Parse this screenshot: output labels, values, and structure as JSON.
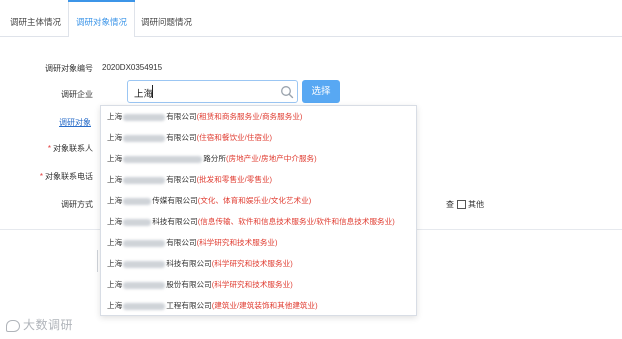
{
  "tabs": [
    {
      "label": "调研主体情况"
    },
    {
      "label": "调研对象情况"
    },
    {
      "label": "调研问题情况"
    }
  ],
  "form": {
    "code_label": "调研对象编号",
    "code_value": "2020DX0354915",
    "company_label": "调研企业",
    "search_value": "上海",
    "select_button": "选择",
    "object_link": "调研对象",
    "contact_label": "对象联系人",
    "phone_label": "对象联系电话",
    "method_label": "调研方式",
    "required_mark": "*",
    "cut_option_suffix": "查",
    "other_option": "其他"
  },
  "dropdown": {
    "items": [
      {
        "prefix": "上海",
        "suffix": "有限公司",
        "industry": "(租赁和商务服务业/商务服务业)"
      },
      {
        "prefix": "上海",
        "suffix": "有限公司",
        "industry": "(住宿和餐饮业/住宿业)"
      },
      {
        "prefix": "上海",
        "suffix": "路分所",
        "industry": "(房地产业/房地产中介服务)"
      },
      {
        "prefix": "上海",
        "suffix": "有限公司",
        "industry": "(批发和零售业/零售业)"
      },
      {
        "prefix": "上海",
        "suffix": "传媒有限公司",
        "industry": "(文化、体育和娱乐业/文化艺术业)"
      },
      {
        "prefix": "上海",
        "suffix": "科技有限公司",
        "industry": "(信息传输、软件和信息技术服务业/软件和信息技术服务业)"
      },
      {
        "prefix": "上海",
        "suffix": "有限公司",
        "industry": "(科学研究和技术服务业)"
      },
      {
        "prefix": "上海",
        "suffix": "科技有限公司",
        "industry": "(科学研究和技术服务业)"
      },
      {
        "prefix": "上海",
        "suffix": "股份有限公司",
        "industry": "(科学研究和技术服务业)"
      },
      {
        "prefix": "上海",
        "suffix": "工程有限公司",
        "industry": "(建筑业/建筑装饰和其他建筑业)"
      }
    ]
  },
  "watermark": {
    "text": "大数调研"
  },
  "colors": {
    "accent": "#3c95e8",
    "button": "#58a8f3",
    "industry_text": "#e03c31",
    "required": "#e23b3b"
  },
  "icons": {
    "search": "search-icon"
  }
}
